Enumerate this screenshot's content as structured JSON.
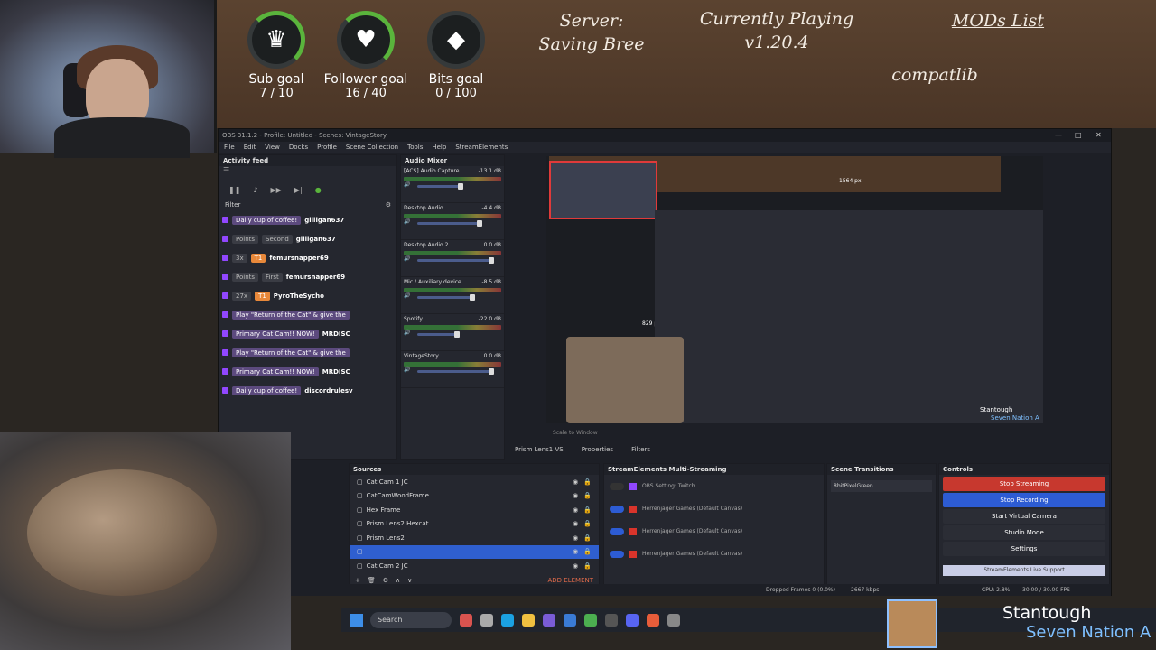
{
  "overlay": {
    "goals": [
      {
        "label": "Sub goal",
        "value": "7 / 10",
        "icon": "crown-icon",
        "glyph": "♛"
      },
      {
        "label": "Follower goal",
        "value": "16 / 40",
        "icon": "heart-icon",
        "glyph": "♥"
      },
      {
        "label": "Bits goal",
        "value": "0 / 100",
        "icon": "bits-gem-icon",
        "glyph": "◆"
      }
    ],
    "server_label": "Server:",
    "server_name": "Saving Bree",
    "playing_label": "Currently Playing",
    "playing_version": "v1.20.4",
    "mods_label": "MODs List",
    "mods_item": "compatlib"
  },
  "obs": {
    "title": "OBS 31.1.2 - Profile: Untitled - Scenes: VintageStory",
    "menu": [
      "File",
      "Edit",
      "View",
      "Docks",
      "Profile",
      "Scene Collection",
      "Tools",
      "Help",
      "StreamElements"
    ],
    "activity_feed": {
      "title": "Activity feed",
      "filter_label": "Filter",
      "items": [
        {
          "pill": "Daily cup of coffee!",
          "user": "gilligan637",
          "pill_style": "purple"
        },
        {
          "pill": "Second",
          "user": "gilligan637",
          "pill_style": "gray",
          "prefix": "Points"
        },
        {
          "pill": "T1",
          "user": "femursnapper69",
          "pill_style": "orange",
          "prefix": "3x"
        },
        {
          "pill": "First",
          "user": "femursnapper69",
          "pill_style": "gray",
          "prefix": "Points"
        },
        {
          "pill": "T1",
          "user": "PyroTheSycho",
          "pill_style": "orange",
          "prefix": "27x"
        },
        {
          "pill": "Play \"Return of the Cat\" & give the",
          "user": "",
          "pill_style": "purple"
        },
        {
          "pill": "Primary Cat Cam!! NOW!",
          "user": "MRDISC",
          "pill_style": "purple"
        },
        {
          "pill": "Play \"Return of the Cat\" & give the",
          "user": "",
          "pill_style": "purple"
        },
        {
          "pill": "Primary Cat Cam!! NOW!",
          "user": "MRDISC",
          "pill_style": "purple"
        },
        {
          "pill": "Daily cup of coffee!",
          "user": "discordrulesv",
          "pill_style": "purple"
        }
      ],
      "last_user": "MRDISC"
    },
    "audio_mixer": {
      "title": "Audio Mixer",
      "channels": [
        {
          "name": "[ACS] Audio Capture",
          "db": "-13.1 dB",
          "level": 0.6
        },
        {
          "name": "Desktop Audio",
          "db": "-4.4 dB",
          "level": 0.85
        },
        {
          "name": "Desktop Audio 2",
          "db": "0.0 dB",
          "level": 1
        },
        {
          "name": "Mic / Auxiliary device",
          "db": "-8.5 dB",
          "level": 0.75
        },
        {
          "name": "Spotify",
          "db": "-22.0 dB",
          "level": 0.55
        },
        {
          "name": "VintageStory",
          "db": "0.0 dB",
          "level": 1
        }
      ]
    },
    "preview": {
      "measure_1": "1564 px",
      "measure_2": "829 px",
      "streamer": "Stantough",
      "brand": "Seven Nation A",
      "scale_label": "Scale to Window"
    },
    "source_toolbar": {
      "selected_source": "Prism Lens1 VS",
      "properties": "Properties",
      "filters": "Filters"
    },
    "sources": {
      "title": "Sources",
      "items": [
        {
          "name": "Cat Cam 1 JC",
          "selected": false
        },
        {
          "name": "CatCamWoodFrame",
          "selected": false
        },
        {
          "name": "Hex Frame",
          "selected": false
        },
        {
          "name": "Prism Lens2 Hexcat",
          "selected": false
        },
        {
          "name": "Prism Lens2",
          "selected": false
        },
        {
          "name": "",
          "selected": true
        },
        {
          "name": "Cat Cam 2 JC",
          "selected": false
        }
      ],
      "add_element": "ADD ELEMENT"
    },
    "multistream": {
      "title": "StreamElements Multi-Streaming",
      "rows": [
        {
          "label": "OBS Setting: Twitch"
        },
        {
          "label": "Herrenjager Games (Default Canvas)"
        },
        {
          "label": "Herrenjager Games (Default Canvas)"
        },
        {
          "label": "Herrenjager Games (Default Canvas)"
        }
      ]
    },
    "transitions": {
      "title": "Scene Transitions",
      "value": "8bitPixelGreen"
    },
    "controls": {
      "title": "Controls",
      "buttons": [
        {
          "label": "Stop Streaming",
          "style": "red"
        },
        {
          "label": "Stop Recording",
          "style": "blue"
        },
        {
          "label": "Start Virtual Camera",
          "style": "gray"
        },
        {
          "label": "Studio Mode",
          "style": "gray"
        },
        {
          "label": "Settings",
          "style": "gray"
        }
      ],
      "support": "StreamElements Live Support"
    },
    "status": {
      "dropped": "Dropped Frames 0 (0.0%)",
      "bitrate": "2667 kbps",
      "cpu": "CPU: 2.8%",
      "fps": "30.00 / 30.00 FPS"
    }
  },
  "taskbar": {
    "search_placeholder": "Search"
  },
  "branding": {
    "name": "Stantough",
    "sub": "Seven Nation A"
  }
}
